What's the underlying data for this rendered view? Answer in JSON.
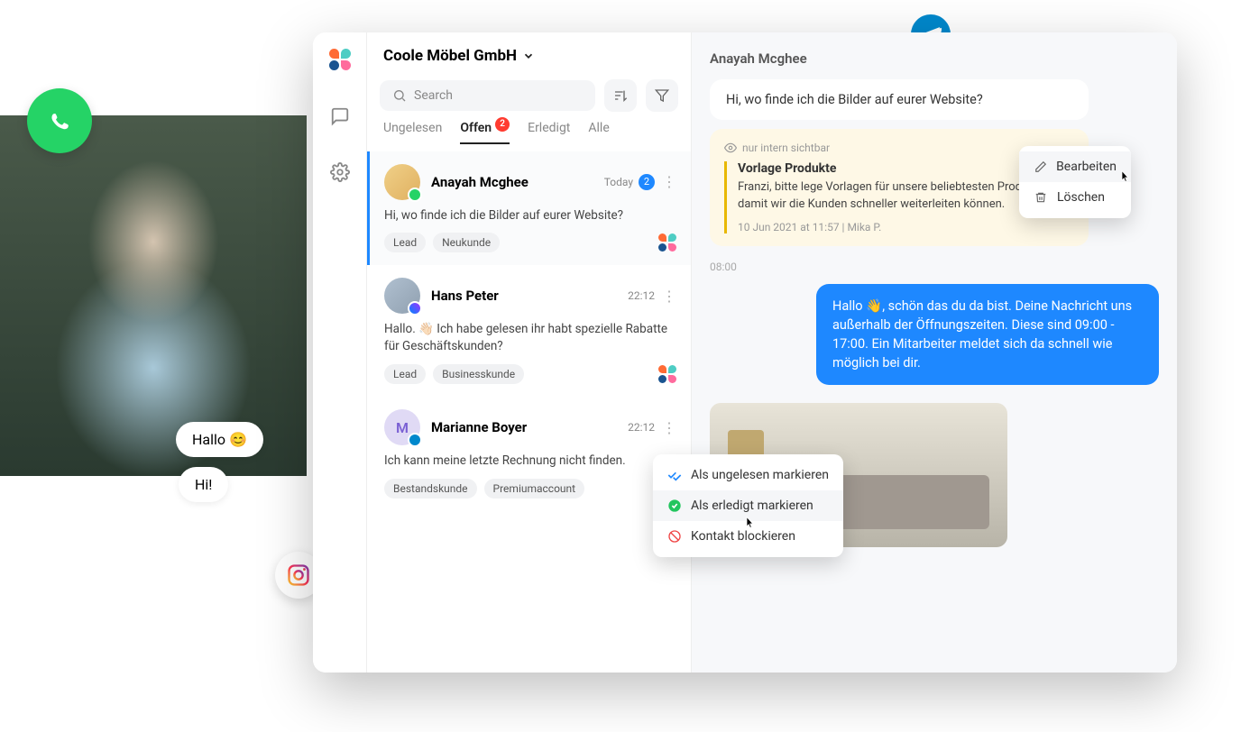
{
  "header": {
    "company": "Coole Möbel GmbH"
  },
  "search": {
    "placeholder": "Search"
  },
  "tabs": {
    "unread": "Ungelesen",
    "open": "Offen",
    "open_badge": "2",
    "done": "Erledigt",
    "all": "Alle"
  },
  "conversations": [
    {
      "name": "Anayah Mcghee",
      "time": "Today",
      "unread": "2",
      "preview": "Hi, wo finde ich die Bilder auf eurer Website?",
      "tags": [
        "Lead",
        "Neukunde"
      ],
      "channel": "whatsapp",
      "avatar_letter": ""
    },
    {
      "name": "Hans Peter",
      "time": "22:12",
      "preview": "Hallo. 👋🏻 Ich habe gelesen ihr habt spezielle Rabatte für Geschäftskunden?",
      "tags": [
        "Lead",
        "Businesskunde"
      ],
      "channel": "messenger",
      "avatar_letter": ""
    },
    {
      "name": "Marianne Boyer",
      "time": "22:12",
      "preview": "Ich kann meine letzte Rechnung nicht finden.",
      "tags": [
        "Bestandskunde",
        "Premiumaccount"
      ],
      "channel": "telegram",
      "avatar_letter": "M"
    }
  ],
  "chat": {
    "contact": "Anayah Mcghee",
    "incoming": "Hi, wo finde ich die Bilder auf eurer Website?",
    "internal_label": "nur intern sichtbar",
    "note_title": "Vorlage Produkte",
    "note_body": "Franzi, bitte lege Vorlagen für unsere beliebtesten Produkte an, damit wir die Kunden schneller weiterleiten können.",
    "note_meta": "10 Jun 2021 at 11:57 | Mika P.",
    "mid_time": "08:00",
    "outgoing": "Hallo 👋, schön das du da bist. Deine Nachricht uns außerhalb der Öffnungszeiten. Diese sind 09:00 - 17:00. Ein Mitarbeiter meldet sich da schnell wie möglich bei dir."
  },
  "context_menu": {
    "mark_unread": "Als ungelesen markieren",
    "mark_done": "Als erledigt markieren",
    "block": "Kontakt blockieren"
  },
  "edit_menu": {
    "edit": "Bearbeiten",
    "delete": "Löschen"
  },
  "bubbles": {
    "hello": "Hallo 😊",
    "hi": "Hi!"
  }
}
